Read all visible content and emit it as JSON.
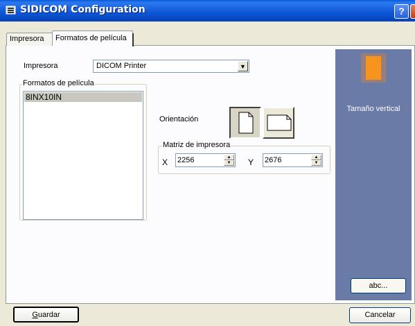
{
  "window": {
    "title": "SIDICOM Configuration",
    "help_label": "?",
    "colors": {
      "titlebar": "#0a5ad8",
      "side_panel": "#6b7ba8",
      "face": "#ece9d8"
    }
  },
  "tabs": [
    {
      "label": "Impresora",
      "active": false
    },
    {
      "label": "Formatos de película",
      "active": true
    }
  ],
  "printer": {
    "label": "Impresora",
    "selected": "DICOM Printer",
    "arrow": "▼"
  },
  "formats": {
    "group_title": "Formatos de película",
    "items": [
      "8INX10IN"
    ]
  },
  "orientation": {
    "label": "Orientación",
    "options": [
      {
        "name": "portrait-icon",
        "selected": true
      },
      {
        "name": "landscape-icon",
        "selected": false
      }
    ]
  },
  "matrix": {
    "group_title": "Matriz de impresora",
    "x_label": "X",
    "x_value": "2256",
    "y_label": "Y",
    "y_value": "2676"
  },
  "side_panel": {
    "caption": "Tamaño vertical",
    "button_label": "abc...",
    "icon": "document-portrait-icon"
  },
  "footer": {
    "save_label": "Guardar",
    "cancel_label": "Cancelar"
  }
}
